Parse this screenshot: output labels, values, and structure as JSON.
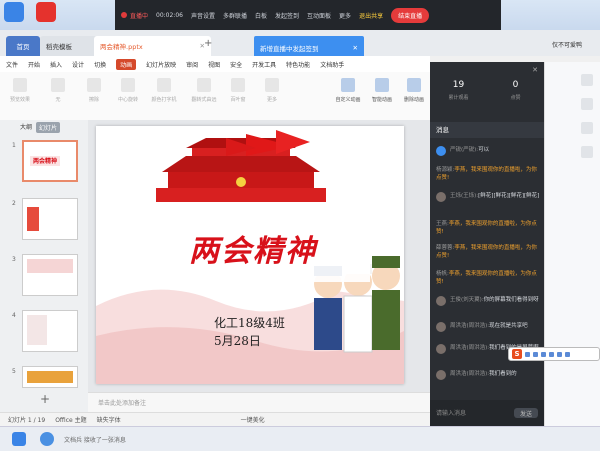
{
  "live_bar": {
    "status": "直播中",
    "timer": "00:02:06",
    "items": [
      "声音设置",
      "多群联播",
      "白板",
      "发起签到",
      "互动面板",
      "更多"
    ],
    "share": "退出共享",
    "end": "结束直播"
  },
  "browser": {
    "tabs": [
      "首页",
      "稻壳模板",
      "两会精神.pptx"
    ],
    "user": "仅不可爱鸭"
  },
  "notification": {
    "text": "新增直播中发起签到"
  },
  "menu": {
    "items": [
      "文件",
      "开始",
      "插入",
      "设计",
      "切换",
      "动画",
      "幻灯片放映",
      "审阅",
      "视图",
      "安全",
      "开发工具",
      "特色功能",
      "文档助手"
    ],
    "active": "动画"
  },
  "ribbon": {
    "items": [
      "预览效果",
      "无",
      "擦除",
      "中心旋转",
      "颜色打字机",
      "翻转式由远",
      "百叶窗",
      "更多",
      "自定义动画",
      "智能动画",
      "删除动画"
    ]
  },
  "left_pane": {
    "view_tabs": [
      "大纲",
      "幻灯片"
    ],
    "slide_numbers": [
      "1",
      "2",
      "3",
      "4",
      "5"
    ]
  },
  "slide": {
    "title": "两会精神",
    "subtitle_line1": "化工18级4班",
    "subtitle_line2": "5月28日"
  },
  "notes": {
    "placeholder": "单击此处添加备注"
  },
  "status_bar": {
    "slide_info": "幻灯片 1 / 19",
    "theme": "Office 主题",
    "font_missing": "缺失字体",
    "beautify": "一键美化"
  },
  "chat": {
    "viewers": "19",
    "viewers_label": "累计观看",
    "likes": "0",
    "likes_label": "点赞",
    "header": "消息",
    "messages": [
      {
        "user": "严锐(严锐):",
        "text": "可以",
        "highlight": false
      },
      {
        "user": "杨源颖:",
        "text": "李燕，我来围观你的直播啦，为你点赞!",
        "highlight": true
      },
      {
        "user": "王烁(王烁):",
        "text": "[鲜花][鲜花][鲜花][鲜花]",
        "highlight": false
      },
      {
        "user": "王燕:",
        "text": "李燕，我来围观你的直播啦，为你点赞!",
        "highlight": true
      },
      {
        "user": "薛蓉蓉:",
        "text": "李燕，我来围观你的直播啦，为你点赞!",
        "highlight": true
      },
      {
        "user": "杨帆:",
        "text": "李燕，我来围观你的直播啦，为你点赞!",
        "highlight": true
      },
      {
        "user": "王俊(刘天翼):",
        "text": "你的屏幕我们看得到呀",
        "highlight": false
      },
      {
        "user": "周洪浩(周洪浩):",
        "text": "现在就是共享吧",
        "highlight": false
      },
      {
        "user": "周洪浩(周洪浩):",
        "text": "我们看到的是屏幕啊",
        "highlight": false
      },
      {
        "user": "周洪浩(周洪浩):",
        "text": "我们看到的",
        "highlight": false
      }
    ],
    "input_placeholder": "请输入消息",
    "send": "发送"
  },
  "taskbar": {
    "notice": "文档兵 接收了一张消息"
  },
  "colors": {
    "accent_red": "#d8111a",
    "live_bar_bg": "#23262b",
    "chat_bg": "#2b2e33",
    "notification_blue": "#3d8ff0"
  }
}
